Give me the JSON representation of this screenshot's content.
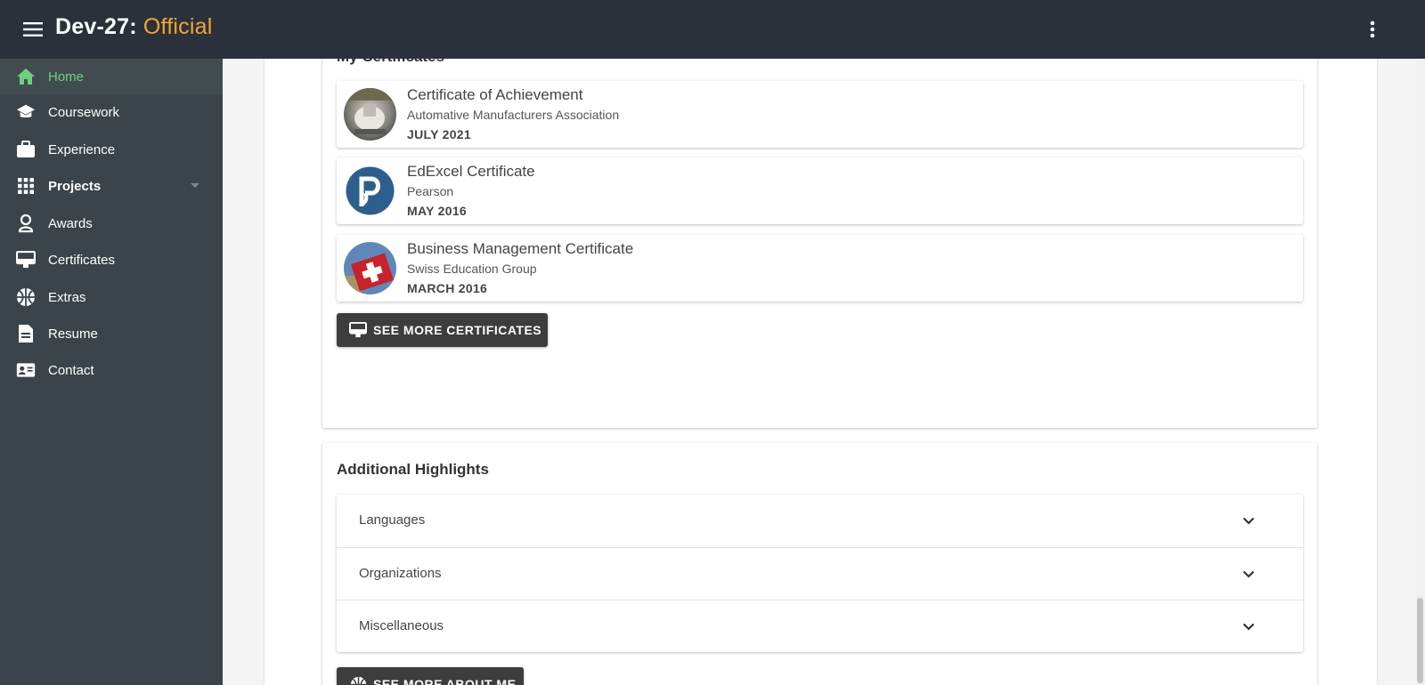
{
  "app": {
    "title_main": "Dev-27:",
    "title_accent": "Official",
    "accent_color": "#f0a531"
  },
  "sidebar": {
    "items": [
      {
        "label": "Home",
        "icon": "home-icon",
        "active": true
      },
      {
        "label": "Coursework",
        "icon": "school-icon"
      },
      {
        "label": "Experience",
        "icon": "briefcase-icon"
      },
      {
        "label": "Projects",
        "icon": "grid-icon",
        "expandable": true
      },
      {
        "label": "Awards",
        "icon": "award-icon"
      },
      {
        "label": "Certificates",
        "icon": "certificate-icon"
      },
      {
        "label": "Extras",
        "icon": "ball-icon"
      },
      {
        "label": "Resume",
        "icon": "document-icon"
      },
      {
        "label": "Contact",
        "icon": "contact-card-icon"
      }
    ],
    "active_color": "#6fd07c"
  },
  "certificates": {
    "title": "My Certificates",
    "items": [
      {
        "name": "Certificate of Achievement",
        "issuer": "Automative Manufacturers Association",
        "date": "JULY 2021",
        "logo": "trophy-photo-logo"
      },
      {
        "name": "EdExcel Certificate",
        "issuer": "Pearson",
        "date": "MAY 2016",
        "logo": "pearson-logo"
      },
      {
        "name": "Business Management Certificate",
        "issuer": "Swiss Education Group",
        "date": "MARCH 2016",
        "logo": "swiss-flag-logo"
      }
    ],
    "more_button": "SEE MORE CERTIFICATES"
  },
  "highlights": {
    "title": "Additional Highlights",
    "sections": [
      {
        "label": "Languages"
      },
      {
        "label": "Organizations"
      },
      {
        "label": "Miscellaneous"
      }
    ],
    "more_button": "SEE MORE ABOUT ME"
  }
}
